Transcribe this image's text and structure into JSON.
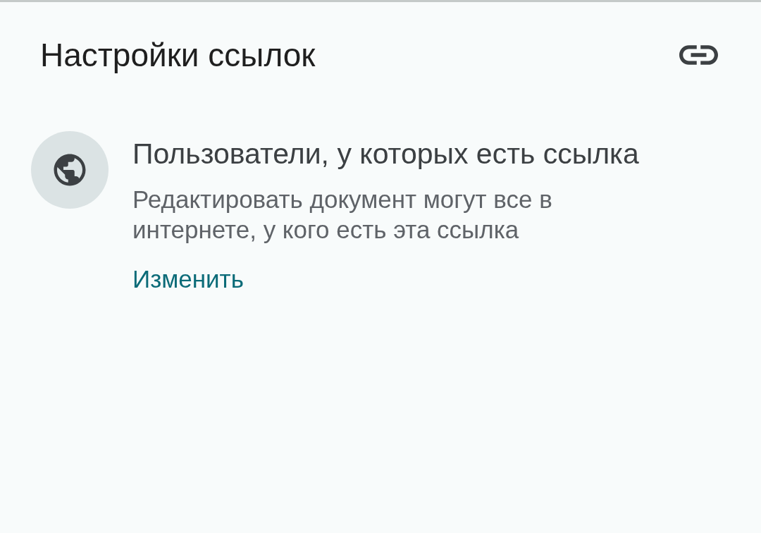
{
  "header": {
    "title": "Настройки ссылок"
  },
  "link_access": {
    "title": "Пользователи, у которых есть ссылка",
    "description": "Редактировать документ могут все в интернете, у кого есть эта ссылка",
    "action": "Изменить"
  }
}
